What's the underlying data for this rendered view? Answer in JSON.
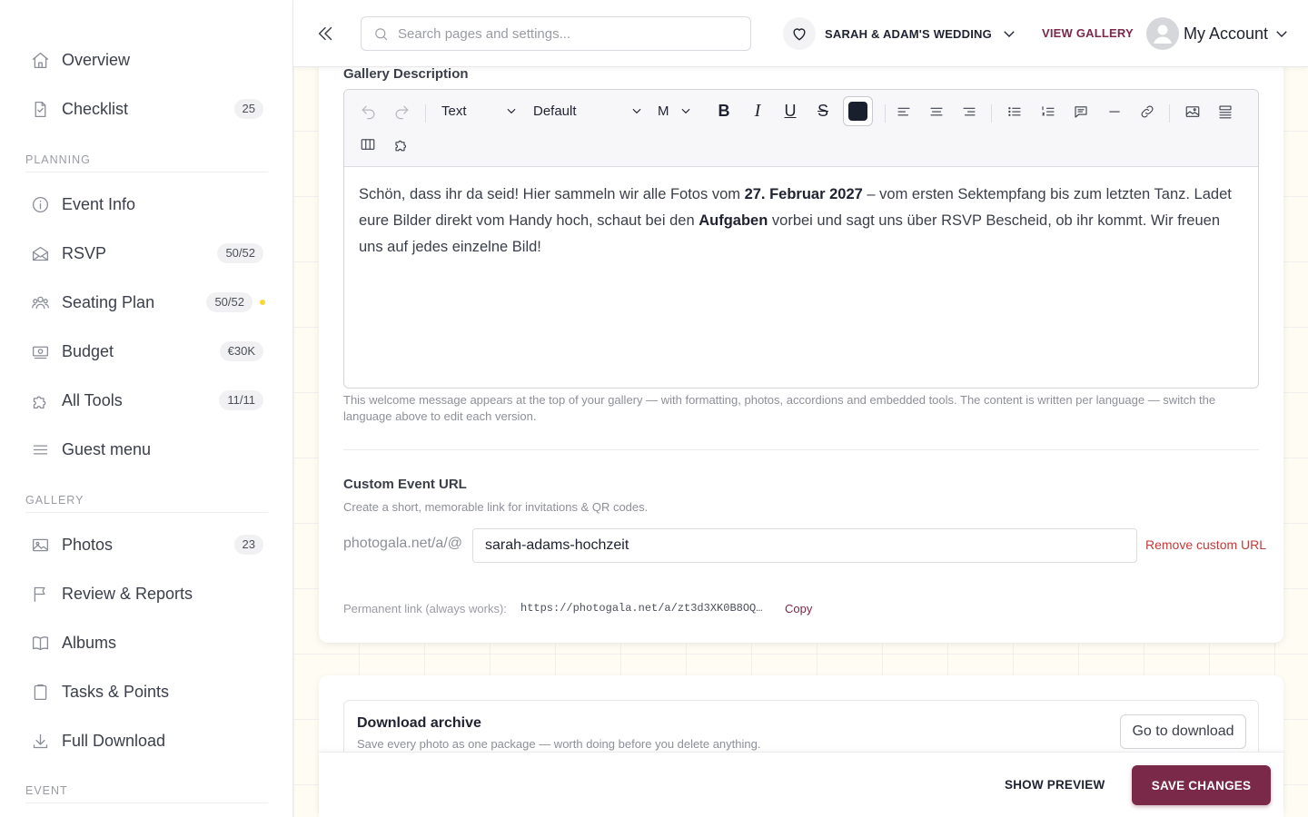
{
  "sidebar": {
    "items_top": [
      {
        "label": "Overview",
        "icon": "home-icon"
      },
      {
        "label": "Checklist",
        "icon": "checklist-icon",
        "badge": "25"
      }
    ],
    "sections": {
      "planning": "PLANNING",
      "gallery": "GALLERY",
      "event": "EVENT"
    },
    "planning_items": [
      {
        "label": "Event Info",
        "icon": "info-icon"
      },
      {
        "label": "RSVP",
        "icon": "envelope-icon",
        "badge": "50/52"
      },
      {
        "label": "Seating Plan",
        "icon": "people-icon",
        "badge": "50/52"
      },
      {
        "label": "Budget",
        "icon": "money-icon",
        "badge": "€30K"
      },
      {
        "label": "All Tools",
        "icon": "puzzle-icon",
        "badge": "11/11"
      },
      {
        "label": "Guest menu",
        "icon": "menu-icon"
      }
    ],
    "gallery_items": [
      {
        "label": "Photos",
        "icon": "image-icon",
        "badge": "23"
      },
      {
        "label": "Review & Reports",
        "icon": "flag-icon"
      },
      {
        "label": "Albums",
        "icon": "book-icon"
      },
      {
        "label": "Tasks & Points",
        "icon": "clipboard-icon"
      },
      {
        "label": "Full Download",
        "icon": "download-icon"
      }
    ],
    "status_dot_color": "#f7d733"
  },
  "header": {
    "search_placeholder": "Search pages and settings...",
    "event_name": "SARAH & ADAM'S WEDDING",
    "view_gallery": "VIEW GALLERY",
    "account_label": "My Account"
  },
  "gallery_description": {
    "title": "Gallery Description",
    "toolbar": {
      "block_type": "Text",
      "font": "Default",
      "size": "M",
      "text_color": "#1a1f2e"
    },
    "content": {
      "p1": "Schön, dass ihr da seid! Hier sammeln wir alle Fotos vom ",
      "b1": "27. Februar 2027",
      "p2": " – vom ersten Sektempfang bis zum letzten Tanz. Ladet eure Bilder direkt vom Handy hoch, schaut bei den ",
      "b2": "Aufgaben",
      "p3": " vorbei und sagt uns über RSVP Bescheid, ob ihr kommt. Wir freuen uns auf jedes einzelne Bild!"
    },
    "help": "This welcome message appears at the top of your gallery — with formatting, photos, accordions and embedded tools. The content is written per language — switch the language above to edit each version."
  },
  "custom_url": {
    "title": "Custom Event URL",
    "subtitle": "Create a short, memorable link for invitations & QR codes.",
    "prefix": "photogala.net/a/@",
    "value": "sarah-adams-hochzeit",
    "remove_label": "Remove custom URL",
    "permanent_label": "Permanent link (always works):",
    "permanent_link": "https://photogala.net/a/zt3d3XK0B8OQ…",
    "copy_label": "Copy"
  },
  "download_archive": {
    "title": "Download archive",
    "subtitle": "Save every photo as one package — worth doing before you delete anything.",
    "button": "Go to download"
  },
  "actions": {
    "preview": "SHOW PREVIEW",
    "save": "SAVE CHANGES"
  },
  "colors": {
    "brand": "#7a2a48",
    "danger": "#c53a3a"
  }
}
